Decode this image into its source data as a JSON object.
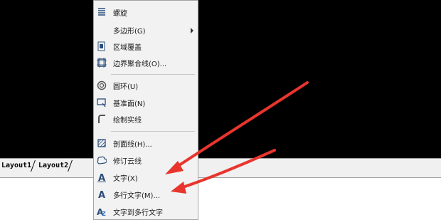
{
  "layout_tabs": [
    "Layout1",
    "Layout2"
  ],
  "menu": [
    {
      "label": "螺旋",
      "icon": "helix-icon",
      "has_submenu": false
    },
    {
      "label": "多边形(G)",
      "icon": "polygon-icon",
      "has_submenu": true
    },
    {
      "label": "区域覆盖",
      "icon": "wipeout-icon",
      "has_submenu": false
    },
    {
      "label": "边界聚合线(O)...",
      "icon": "boundary-icon",
      "has_submenu": false
    },
    {
      "label": "圆环(U)",
      "icon": "donut-icon",
      "has_submenu": false
    },
    {
      "label": "基准面(N)",
      "icon": "datum-plane-icon",
      "has_submenu": false
    },
    {
      "label": "绘制实线",
      "icon": "draw-solid-icon",
      "has_submenu": false
    },
    {
      "label": "剖面线(H)...",
      "icon": "hatch-icon",
      "has_submenu": false
    },
    {
      "label": "修订云线",
      "icon": "revision-cloud-icon",
      "has_submenu": false
    },
    {
      "label": "文字(X)",
      "icon": "text-icon",
      "has_submenu": false
    },
    {
      "label": "多行文字(M)...",
      "icon": "mtext-icon",
      "has_submenu": false
    },
    {
      "label": "文字到多行文字",
      "icon": "text-to-mtext-icon",
      "has_submenu": false
    }
  ],
  "colors": {
    "arrow": "#e8352d",
    "canvas": "#000000"
  }
}
